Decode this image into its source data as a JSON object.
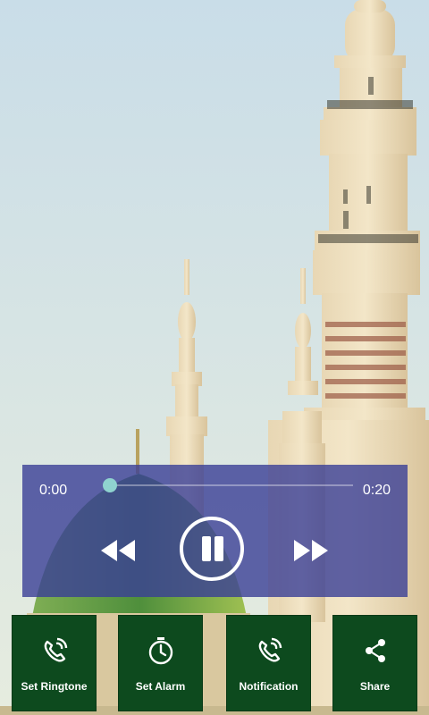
{
  "player": {
    "current_time": "0:00",
    "total_time": "0:20",
    "progress": 0.0,
    "state": "playing",
    "accent_color": "#8fd3cf",
    "rewind_icon": "rewind-icon",
    "pause_icon": "pause-icon",
    "forward_icon": "fast-forward-icon"
  },
  "actions": [
    {
      "label": "Set Ringtone",
      "icon": "phone-ringing-icon"
    },
    {
      "label": "Set Alarm",
      "icon": "stopwatch-icon"
    },
    {
      "label": "Notification",
      "icon": "phone-ringing-icon"
    },
    {
      "label": "Share",
      "icon": "share-icon"
    }
  ],
  "colors": {
    "panel": "#3a3e96",
    "button": "#0d4a1e",
    "dome": "#3f8a3a"
  }
}
